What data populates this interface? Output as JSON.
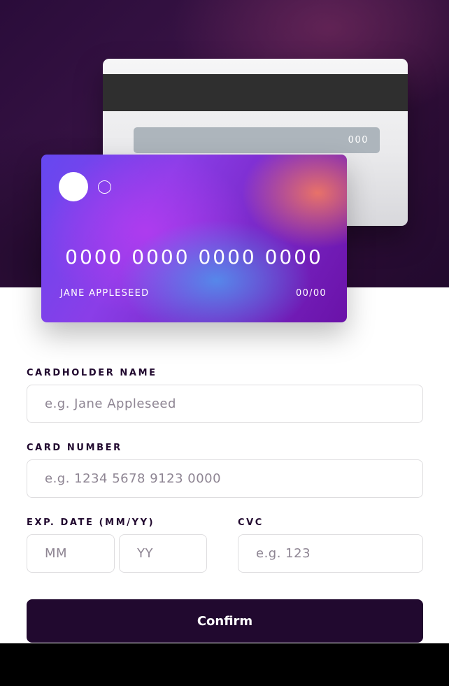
{
  "card_back": {
    "cvc": "000"
  },
  "card_front": {
    "number": "0000 0000 0000 0000",
    "name": "JANE APPLESEED",
    "expiry": "00/00"
  },
  "form": {
    "cardholder_label": "CARDHOLDER NAME",
    "cardholder_placeholder": "e.g. Jane Appleseed",
    "number_label": "CARD NUMBER",
    "number_placeholder": "e.g. 1234 5678 9123 0000",
    "exp_label": "EXP. DATE (MM/YY)",
    "mm_placeholder": "MM",
    "yy_placeholder": "YY",
    "cvc_label": "CVC",
    "cvc_placeholder": "e.g. 123",
    "confirm_label": "Confirm"
  },
  "colors": {
    "dark_violet": "#21092f",
    "input_border": "#dedddf",
    "placeholder": "#8e8593",
    "card_gradient_start": "#6548f0",
    "card_gradient_end": "#6a12a8"
  },
  "icons": {
    "card_logo_large": "filled-circle-icon",
    "card_logo_small": "outline-circle-icon"
  }
}
